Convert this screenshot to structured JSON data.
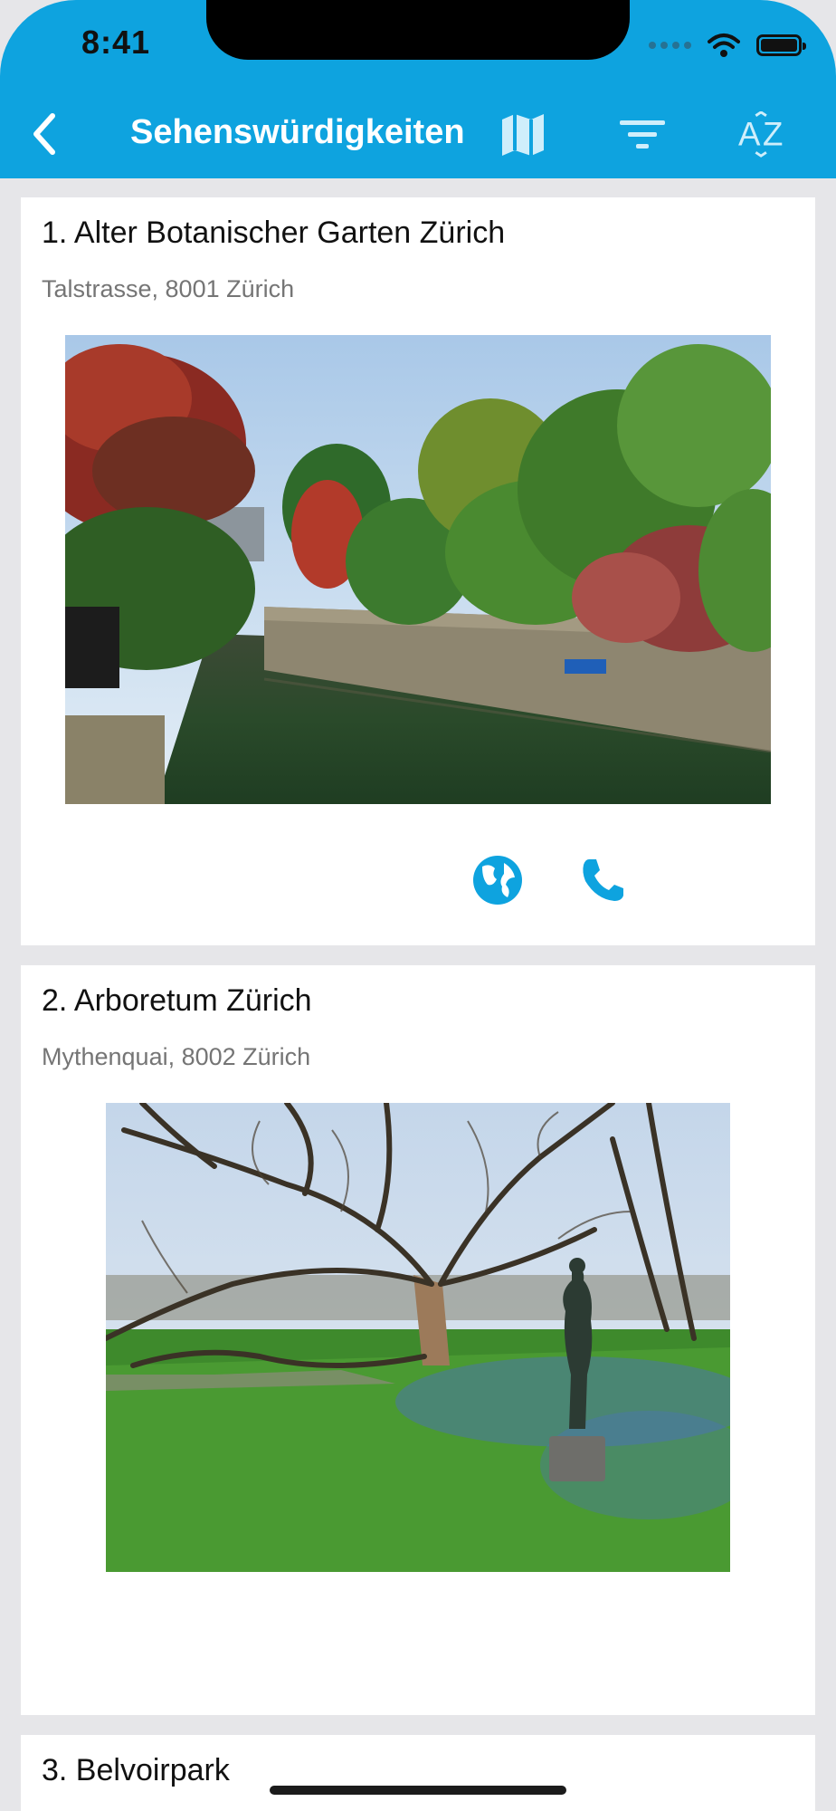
{
  "status_bar": {
    "time": "8:41"
  },
  "nav": {
    "title": "Sehenswürdigkeiten"
  },
  "sights": [
    {
      "title": "1. Alter Botanischer Garten Zürich",
      "address": "Talstrasse, 8001 Zürich"
    },
    {
      "title": "2. Arboretum Zürich",
      "address": "Mythenquai, 8002  Zürich"
    },
    {
      "title": "3. Belvoirpark"
    }
  ],
  "colors": {
    "brand": "#0ea3df",
    "page_bg": "#e6e6e9"
  },
  "icons": [
    "chevron-left-icon",
    "map-icon",
    "filter-icon",
    "sort-az-icon",
    "globe-icon",
    "phone-icon"
  ]
}
